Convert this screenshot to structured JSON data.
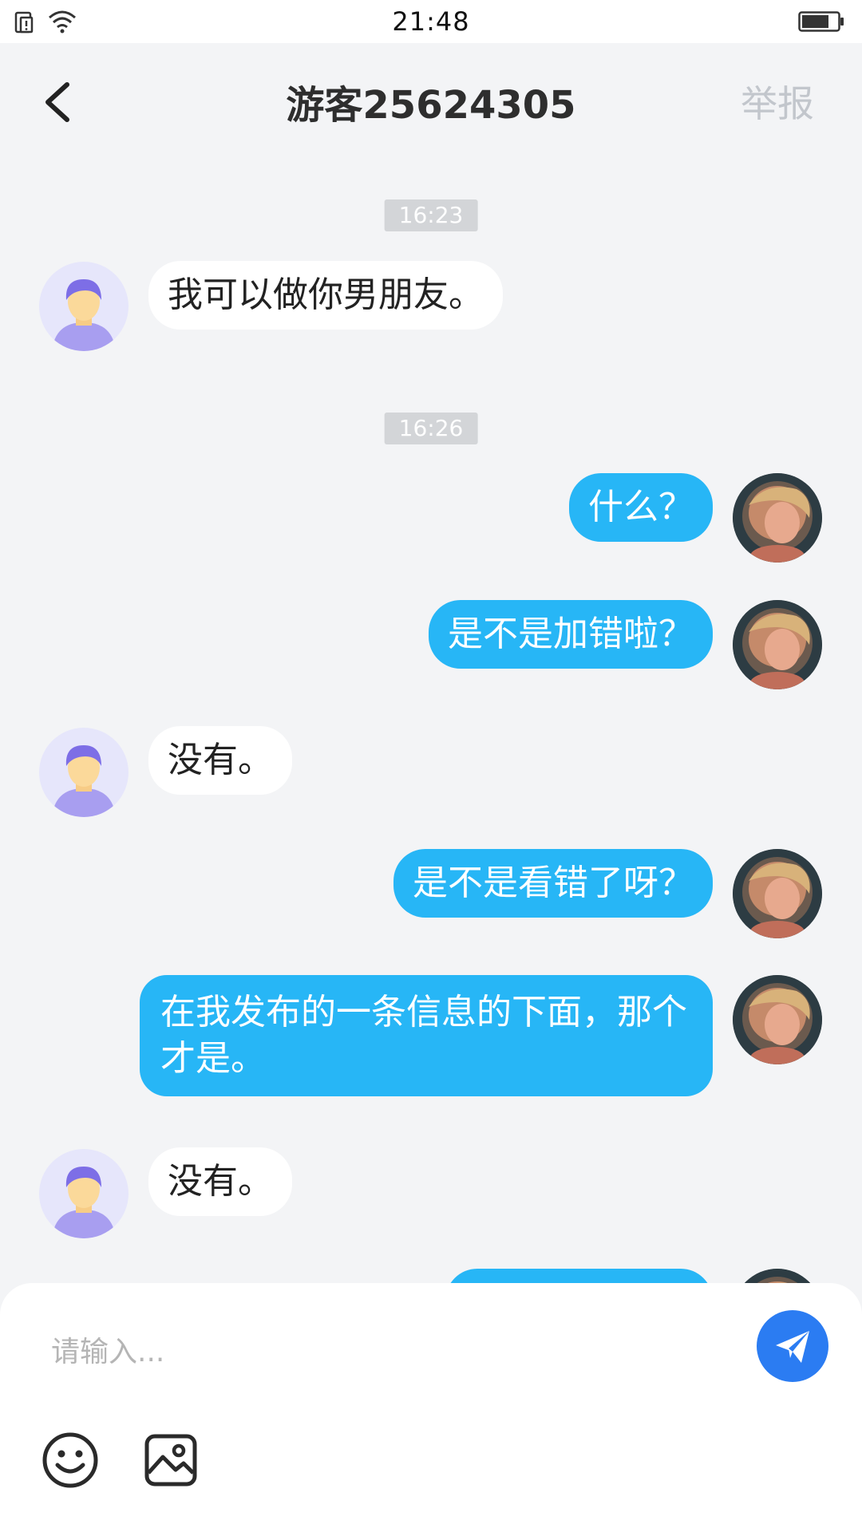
{
  "status_bar": {
    "time": "21:48"
  },
  "header": {
    "title": "游客25624305",
    "report_label": "举报"
  },
  "messages": [
    {
      "type": "time",
      "text": "16:23"
    },
    {
      "type": "received",
      "text": "我可以做你男朋友。"
    },
    {
      "type": "time",
      "text": "16:26"
    },
    {
      "type": "sent",
      "text": "什么？"
    },
    {
      "type": "sent",
      "text": "是不是加错啦？"
    },
    {
      "type": "received",
      "text": "没有。"
    },
    {
      "type": "sent",
      "text": "是不是看错了呀？"
    },
    {
      "type": "sent",
      "text": "在我发布的一条信息的下面，那个才是。"
    },
    {
      "type": "received",
      "text": "没有。"
    },
    {
      "type": "sent",
      "text": ""
    }
  ],
  "input": {
    "placeholder": "请输入..."
  },
  "icons": {
    "back": "chevron-left-icon",
    "send": "paper-plane-icon",
    "emoji": "smiley-icon",
    "image": "image-icon"
  },
  "colors": {
    "sent_bubble": "#27b6f6",
    "send_button": "#2b7cf2",
    "background": "#f3f4f6"
  }
}
